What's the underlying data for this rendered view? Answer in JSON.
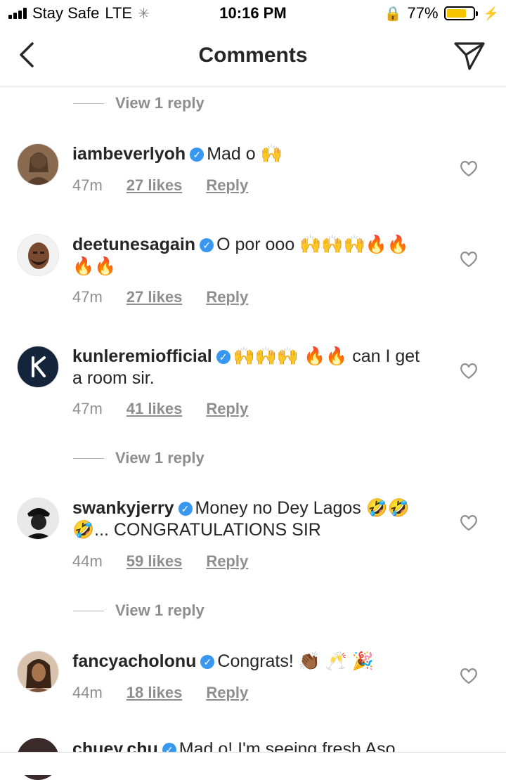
{
  "status_bar": {
    "carrier": "Stay Safe",
    "network": "LTE",
    "time": "10:16 PM",
    "battery": "77%",
    "battery_level": 0.77
  },
  "header": {
    "title": "Comments"
  },
  "view_reply_label": "View 1 reply",
  "comments": [
    {
      "user": "iambeverlyoh",
      "text": "Mad o 🙌",
      "time": "47m",
      "likes": "27 likes",
      "reply": "Reply"
    },
    {
      "user": "deetunesagain",
      "text": "O por ooo 🙌🙌🙌🔥🔥🔥🔥",
      "time": "47m",
      "likes": "27 likes",
      "reply": "Reply"
    },
    {
      "user": "kunleremiofficial",
      "text": "🙌🙌🙌 🔥🔥 can I get a room sir.",
      "time": "47m",
      "likes": "41 likes",
      "reply": "Reply"
    },
    {
      "user": "swankyjerry",
      "text": "Money no Dey Lagos 🤣🤣🤣... CONGRATULATIONS SIR",
      "time": "44m",
      "likes": "59 likes",
      "reply": "Reply"
    },
    {
      "user": "fancyacholonu",
      "text": "Congrats! 👏🏾 🥂 🎉",
      "time": "44m",
      "likes": "18 likes",
      "reply": "Reply"
    }
  ],
  "peek": {
    "user": "chuey.chu",
    "text": "Mad o! I'm seeing fresh Aso"
  }
}
